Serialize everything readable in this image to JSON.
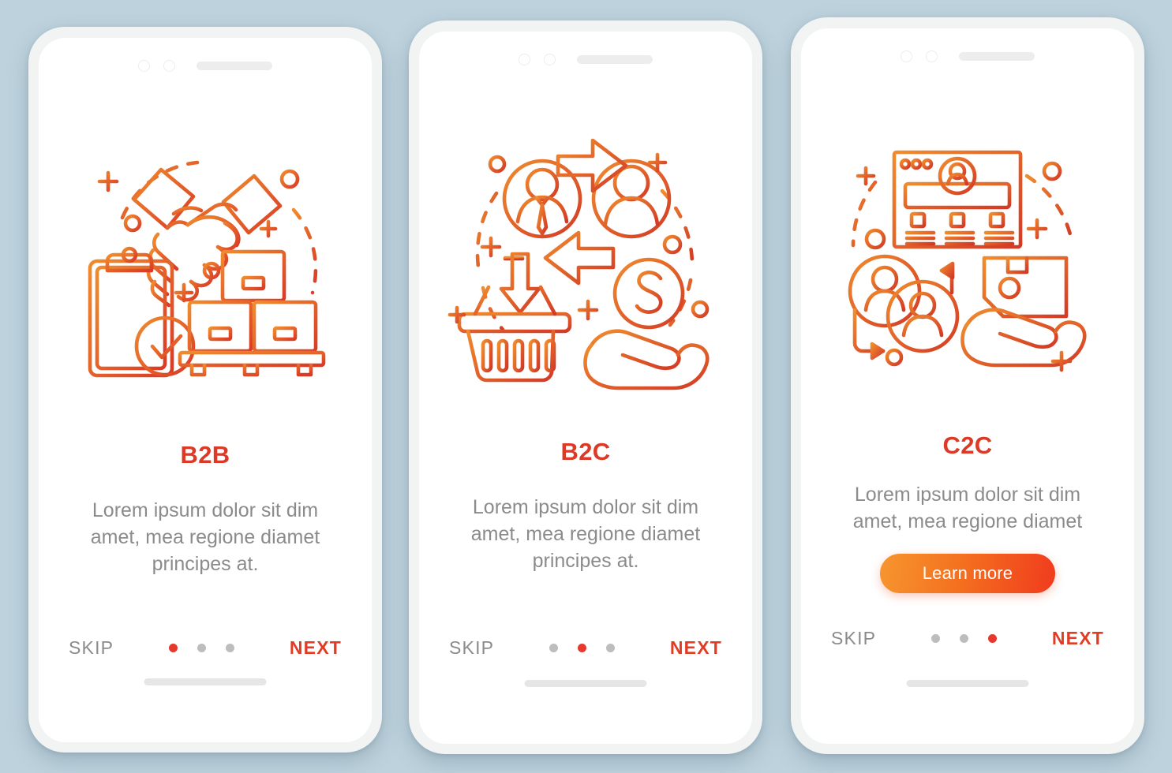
{
  "background_color": "#bdd2dd",
  "theme": {
    "title_color": "#dc3a27",
    "body_color": "#8b8b8b",
    "next_color": "#e23c25",
    "skip_color": "#8b8b8b",
    "dot_active_color": "#e8372b",
    "dot_inactive_color": "#bdbdbd",
    "cta_gradient_from": "#f7962f",
    "cta_gradient_to": "#f03b1e",
    "illustration_gradient_from": "#f08c2e",
    "illustration_gradient_to": "#d93a26"
  },
  "screens": [
    {
      "id": "b2b",
      "title": "B2B",
      "body": "Lorem ipsum dolor sit dim amet, mea regione diamet principes at.",
      "skip_label": "SKIP",
      "next_label": "NEXT",
      "active_dot": 0,
      "dot_count": 3,
      "cta": null,
      "illustration_name": "handshake-clipboard-boxes-illustration"
    },
    {
      "id": "b2c",
      "title": "B2C",
      "body": "Lorem ipsum dolor sit dim amet, mea regione diamet principes at.",
      "skip_label": "SKIP",
      "next_label": "NEXT",
      "active_dot": 1,
      "dot_count": 3,
      "cta": null,
      "illustration_name": "avatars-basket-coin-hand-illustration"
    },
    {
      "id": "c2c",
      "title": "C2C",
      "body": "Lorem ipsum dolor sit dim amet, mea regione diamet",
      "skip_label": "SKIP",
      "next_label": "NEXT",
      "active_dot": 2,
      "dot_count": 3,
      "cta": "Learn more",
      "illustration_name": "marketplace-users-package-illustration"
    }
  ]
}
